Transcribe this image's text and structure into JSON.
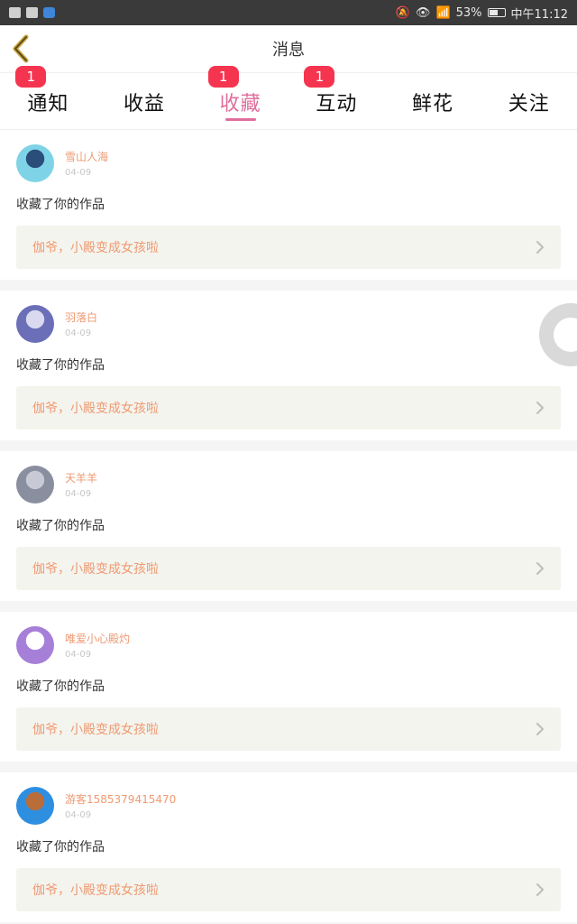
{
  "statusbar": {
    "battery": "53%",
    "time": "中午11:12",
    "battery_level": 0.53,
    "icons_left": [
      "android-notification-icon",
      "android-notification-icon",
      "app-notification-icon"
    ],
    "icons_right": [
      "mute-icon",
      "eye-icon",
      "wifi-icon",
      "battery-icon"
    ]
  },
  "header": {
    "title": "消息",
    "back_icon": "chevron-left-icon"
  },
  "tabs": [
    {
      "label": "通知",
      "badge": "1",
      "active": false
    },
    {
      "label": "收益",
      "badge": "",
      "active": false
    },
    {
      "label": "收藏",
      "badge": "1",
      "active": true
    },
    {
      "label": "互动",
      "badge": "1",
      "active": false
    },
    {
      "label": "鲜花",
      "badge": "",
      "active": false
    },
    {
      "label": "关注",
      "badge": "",
      "active": false
    }
  ],
  "colors": {
    "accent": "#e06e9c",
    "badge": "#f5354f",
    "username": "#ee9a72",
    "work_bg": "#f4f4ee"
  },
  "feed": [
    {
      "username": "雪山人海",
      "date": "04-09",
      "action": "收藏了你的作品",
      "work_title": "伽爷，小殿变成女孩啦",
      "avatar_colors": [
        "#7fd3e6",
        "#2a4d7a"
      ]
    },
    {
      "username": "羽落白",
      "date": "04-09",
      "action": "收藏了你的作品",
      "work_title": "伽爷，小殿变成女孩啦",
      "avatar_colors": [
        "#6b6fb8",
        "#d9d9ef"
      ]
    },
    {
      "username": "天羊羊",
      "date": "04-09",
      "action": "收藏了你的作品",
      "work_title": "伽爷，小殿变成女孩啦",
      "avatar_colors": [
        "#8a8fa0",
        "#c7c9d4"
      ]
    },
    {
      "username": "唯爱小心殿灼",
      "date": "04-09",
      "action": "收藏了你的作品",
      "work_title": "伽爷，小殿变成女孩啦",
      "avatar_colors": [
        "#a67fd8",
        "#ffffff"
      ]
    },
    {
      "username": "游客1585379415470",
      "date": "04-09",
      "action": "收藏了你的作品",
      "work_title": "伽爷，小殿变成女孩啦",
      "avatar_colors": [
        "#2e8fe0",
        "#b96d3b"
      ]
    }
  ]
}
